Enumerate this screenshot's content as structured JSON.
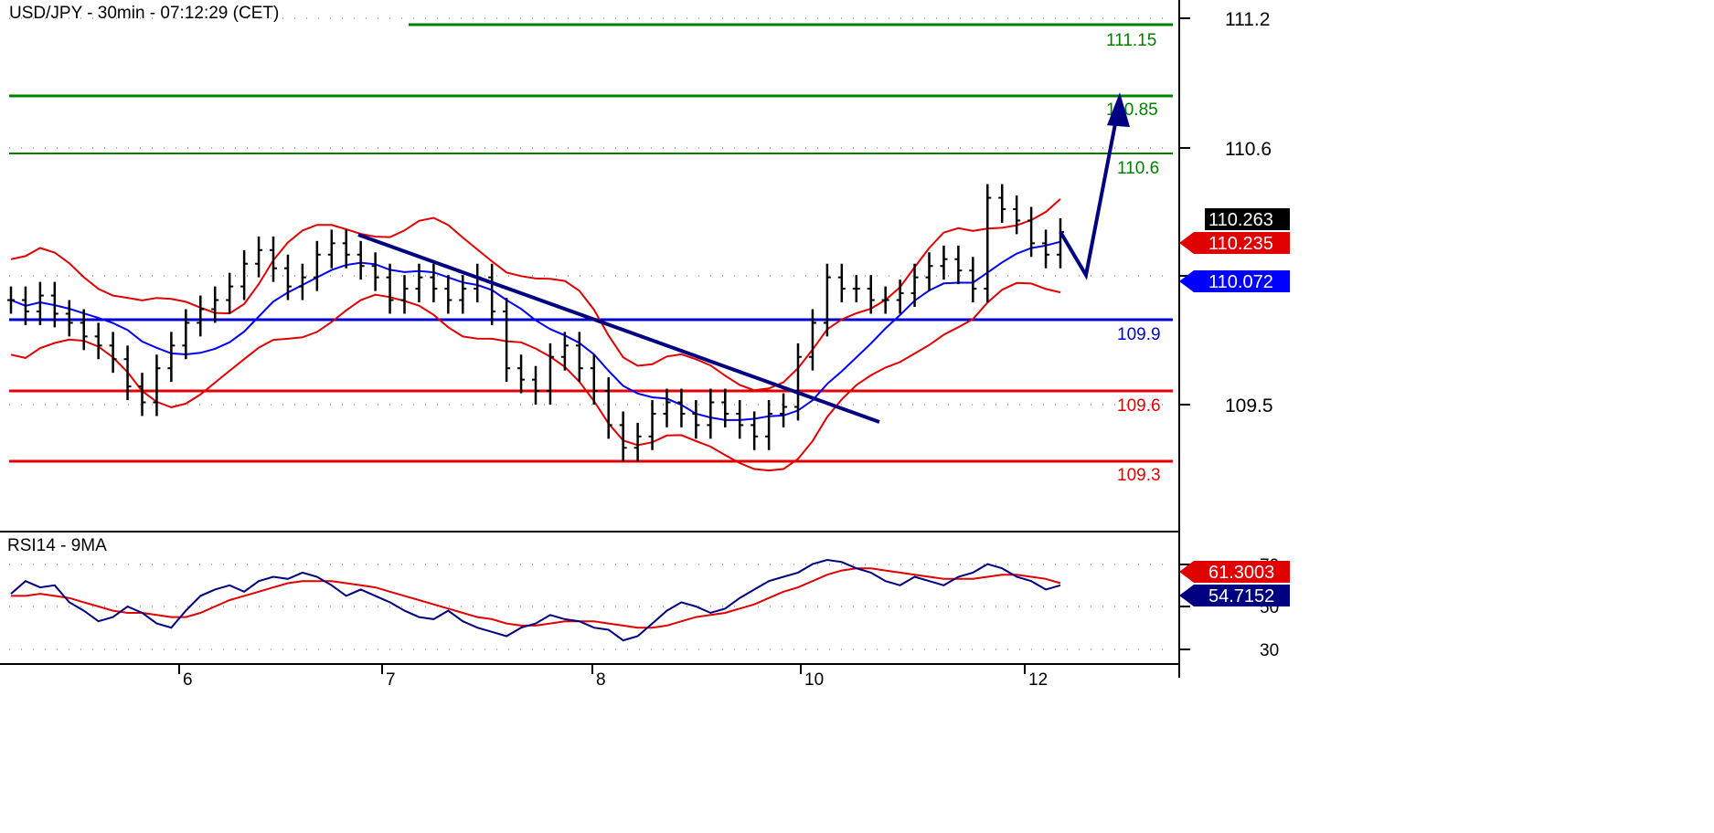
{
  "chart_data": {
    "type": "line",
    "title": "USD/JPY - 30min - 07:12:29 (CET)",
    "price_axis": {
      "ticks": [
        "111.2",
        "110.6",
        "109.5"
      ]
    },
    "x_ticks": [
      "6",
      "7",
      "8",
      "10",
      "12"
    ],
    "levels": [
      {
        "label": "111.15",
        "value": 111.15,
        "color": "#008000"
      },
      {
        "label": "110.85",
        "value": 110.85,
        "color": "#008000"
      },
      {
        "label": "110.6",
        "value": 110.6,
        "color": "#008000"
      },
      {
        "label": "109.9",
        "value": 109.9,
        "color": "#0000cc"
      },
      {
        "label": "109.6",
        "value": 109.6,
        "color": "#e00000"
      },
      {
        "label": "109.3",
        "value": 109.3,
        "color": "#e00000"
      }
    ],
    "price_tags": [
      {
        "label": "110.263",
        "color": "#000000"
      },
      {
        "label": "110.235",
        "color": "#e00000"
      },
      {
        "label": "110.072",
        "color": "#0000ff"
      }
    ],
    "close_series": [
      109.96,
      109.91,
      109.98,
      109.9,
      109.86,
      109.8,
      109.76,
      109.7,
      109.58,
      109.51,
      109.66,
      109.76,
      109.86,
      109.92,
      109.96,
      110.02,
      110.12,
      110.18,
      110.1,
      110.02,
      110.06,
      110.16,
      110.21,
      110.16,
      110.11,
      110.06,
      109.96,
      110.01,
      110.06,
      110.01,
      109.96,
      110.01,
      110.06,
      109.91,
      109.66,
      109.61,
      109.56,
      109.71,
      109.76,
      109.66,
      109.56,
      109.41,
      109.31,
      109.36,
      109.46,
      109.51,
      109.46,
      109.41,
      109.51,
      109.46,
      109.41,
      109.36,
      109.46,
      109.49,
      109.71,
      109.86,
      110.06,
      110.01,
      110.01,
      109.96,
      109.96,
      109.99,
      110.06,
      110.11,
      110.14,
      110.09,
      110.01,
      110.41,
      110.36,
      110.31,
      110.21,
      110.16,
      110.26
    ],
    "forecast_path": [
      [
        110.26,
        110.07
      ],
      [
        110.07,
        110.85
      ]
    ],
    "rsi": {
      "title": "RSI14 - 9MA",
      "ticks": [
        "70",
        "50",
        "30"
      ],
      "tags": [
        {
          "label": "61.3003",
          "color": "#e00000"
        },
        {
          "label": "54.7152",
          "color": "#000080"
        }
      ],
      "rsi_series": [
        56,
        62,
        59,
        60,
        52,
        48,
        43,
        45,
        50,
        47,
        42,
        40,
        48,
        55,
        58,
        60,
        57,
        62,
        64,
        63,
        66,
        64,
        60,
        55,
        58,
        55,
        52,
        48,
        45,
        44,
        48,
        43,
        40,
        38,
        36,
        40,
        42,
        46,
        44,
        43,
        40,
        39,
        34,
        36,
        42,
        48,
        52,
        50,
        47,
        49,
        54,
        58,
        62,
        64,
        66,
        70,
        72,
        71,
        68,
        66,
        62,
        60,
        64,
        62,
        60,
        64,
        66,
        70,
        68,
        64,
        62,
        58,
        60
      ],
      "ma_series": [
        55,
        55,
        56,
        55,
        54,
        52,
        50,
        48,
        47,
        47,
        46,
        45,
        45,
        47,
        50,
        53,
        55,
        57,
        59,
        61,
        62,
        62,
        62,
        61,
        60,
        59,
        57,
        55,
        53,
        51,
        49,
        47,
        45,
        44,
        42,
        41,
        41,
        42,
        43,
        43,
        43,
        42,
        41,
        40,
        40,
        41,
        43,
        45,
        46,
        47,
        49,
        51,
        54,
        57,
        59,
        62,
        65,
        67,
        68,
        68,
        67,
        66,
        65,
        64,
        63,
        63,
        63,
        64,
        65,
        65,
        64,
        63,
        61
      ]
    }
  }
}
